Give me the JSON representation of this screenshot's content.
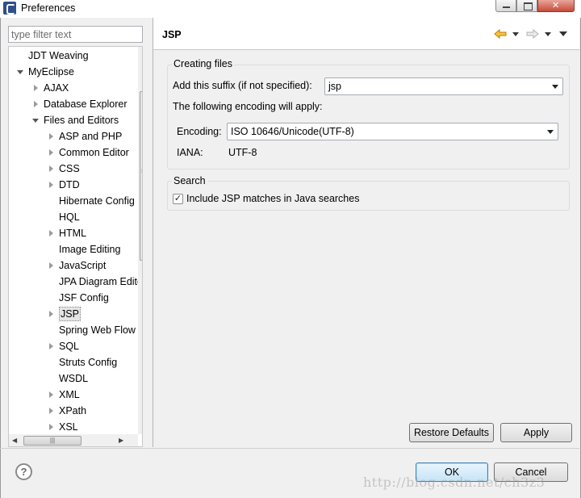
{
  "window": {
    "title": "Preferences"
  },
  "filter": {
    "placeholder": "type filter text"
  },
  "tree": {
    "items": [
      {
        "label": "JDT Weaving",
        "twisty": "none",
        "indent": 1
      },
      {
        "label": "MyEclipse",
        "twisty": "open",
        "indent": 1
      },
      {
        "label": "AJAX",
        "twisty": "closed",
        "indent": 2
      },
      {
        "label": "Database Explorer",
        "twisty": "closed",
        "indent": 2
      },
      {
        "label": "Files and Editors",
        "twisty": "open",
        "indent": 2
      },
      {
        "label": "ASP and PHP",
        "twisty": "closed",
        "indent": 3
      },
      {
        "label": "Common Editor",
        "twisty": "closed",
        "indent": 3
      },
      {
        "label": "CSS",
        "twisty": "closed",
        "indent": 3
      },
      {
        "label": "DTD",
        "twisty": "closed",
        "indent": 3
      },
      {
        "label": "Hibernate Config",
        "twisty": "none",
        "indent": 3
      },
      {
        "label": "HQL",
        "twisty": "none",
        "indent": 3
      },
      {
        "label": "HTML",
        "twisty": "closed",
        "indent": 3
      },
      {
        "label": "Image Editing",
        "twisty": "none",
        "indent": 3
      },
      {
        "label": "JavaScript",
        "twisty": "closed",
        "indent": 3
      },
      {
        "label": "JPA Diagram Editor",
        "twisty": "none",
        "indent": 3
      },
      {
        "label": "JSF Config",
        "twisty": "none",
        "indent": 3
      },
      {
        "label": "JSP",
        "twisty": "closed",
        "indent": 3,
        "selected": true
      },
      {
        "label": "Spring Web Flow",
        "twisty": "none",
        "indent": 3
      },
      {
        "label": "SQL",
        "twisty": "closed",
        "indent": 3
      },
      {
        "label": "Struts Config",
        "twisty": "none",
        "indent": 3
      },
      {
        "label": "WSDL",
        "twisty": "none",
        "indent": 3
      },
      {
        "label": "XML",
        "twisty": "closed",
        "indent": 3
      },
      {
        "label": "XPath",
        "twisty": "closed",
        "indent": 3
      },
      {
        "label": "XSL",
        "twisty": "closed",
        "indent": 3
      }
    ]
  },
  "page": {
    "title": "JSP",
    "creating_files": {
      "group_label": "Creating files",
      "suffix_label": "Add this suffix (if not specified):",
      "suffix_value": "jsp",
      "encoding_note": "The following encoding will apply:",
      "encoding_label": "Encoding:",
      "encoding_value": "ISO 10646/Unicode(UTF-8)",
      "iana_label": "IANA:",
      "iana_value": "UTF-8"
    },
    "search": {
      "group_label": "Search",
      "checkbox_label": "Include JSP matches in Java searches",
      "checked": true
    },
    "restore_defaults_label": "Restore Defaults",
    "apply_label": "Apply"
  },
  "footer": {
    "ok_label": "OK",
    "cancel_label": "Cancel",
    "help_symbol": "?"
  },
  "watermark": "http://blog.csdn.net/ch3z3",
  "icons": {
    "back": "back-arrow-icon",
    "forward": "forward-arrow-icon",
    "view_menu": "view-menu-icon",
    "help": "help-icon"
  },
  "colors": {
    "nav_arrow": "#e8a000",
    "nav_arrow_disabled": "#c8c8c8",
    "selection": "#e5e5e5"
  }
}
